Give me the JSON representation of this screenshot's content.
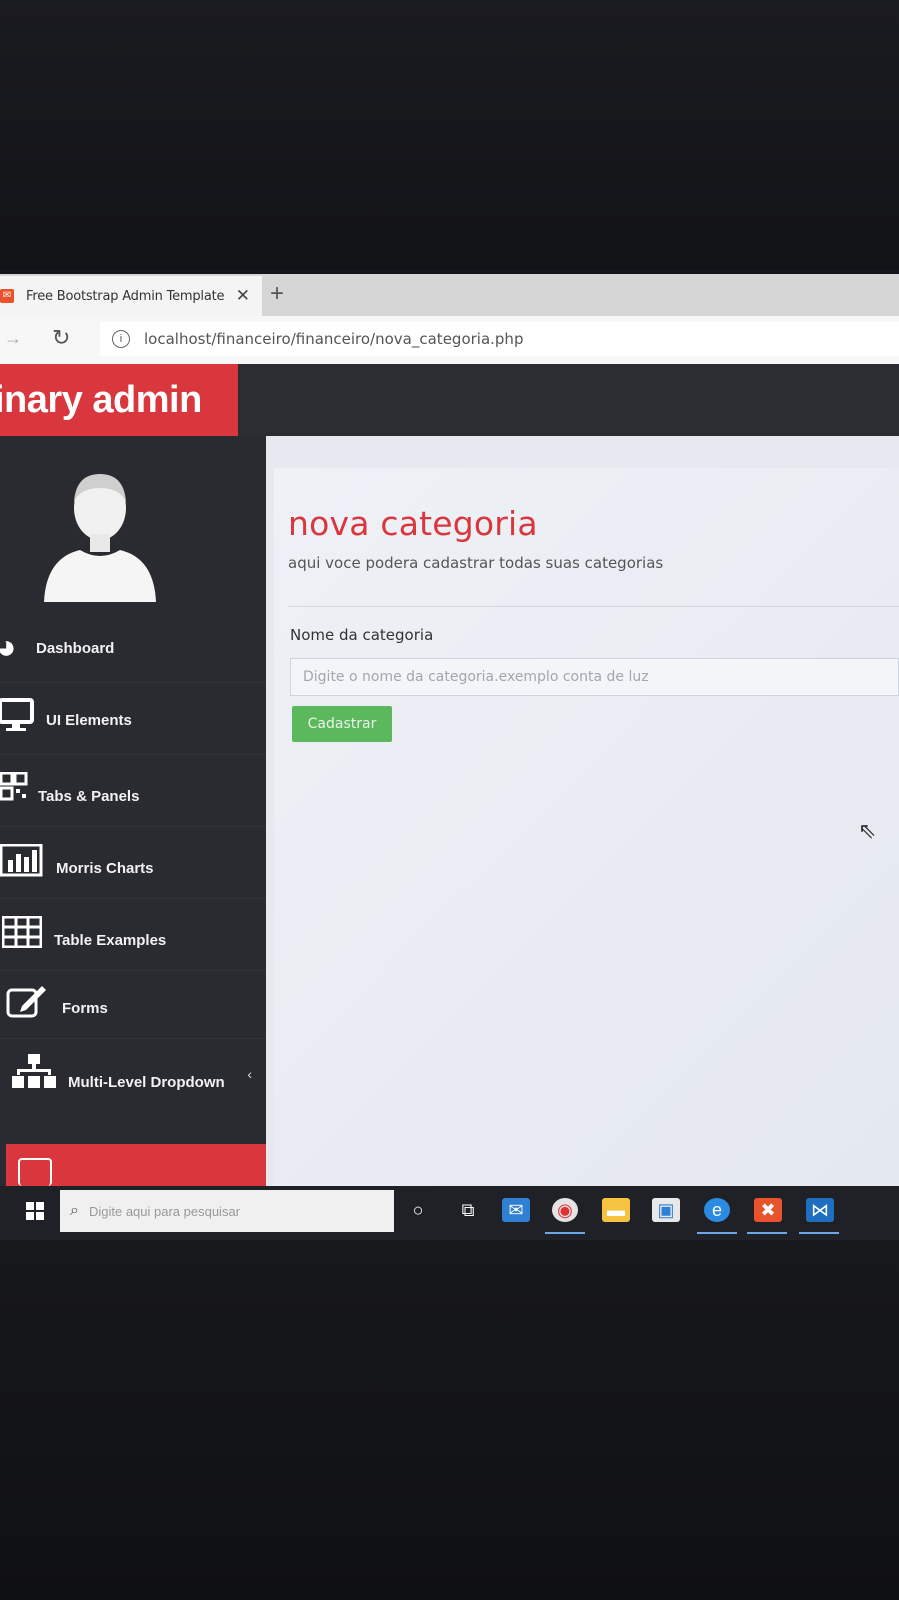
{
  "browser": {
    "tab_title": "Free Bootstrap Admin Template",
    "tab_close": "✕",
    "new_tab": "+",
    "url": "localhost/financeiro/financeiro/nova_categoria.php"
  },
  "app": {
    "brand": "inary admin"
  },
  "sidebar": {
    "items": [
      {
        "label": "Dashboard",
        "icon": "palette-icon"
      },
      {
        "label": "UI Elements",
        "icon": "desktop-icon"
      },
      {
        "label": "Tabs & Panels",
        "icon": "qrcode-icon"
      },
      {
        "label": "Morris Charts",
        "icon": "bar-chart-icon"
      },
      {
        "label": "Table Examples",
        "icon": "table-icon"
      },
      {
        "label": "Forms",
        "icon": "edit-icon"
      },
      {
        "label": "Multi-Level Dropdown",
        "icon": "sitemap-icon"
      }
    ],
    "collapse": "‹"
  },
  "main": {
    "title": "nova categoria",
    "subtitle": "aqui voce podera cadastrar todas suas categorias",
    "field_label": "Nome da categoria",
    "field_placeholder": "Digite o nome da categoria.exemplo conta de luz",
    "submit_label": "Cadastrar"
  },
  "taskbar": {
    "search_placeholder": "Digite aqui para pesquisar"
  },
  "colors": {
    "accent": "#d9363e",
    "sidebar": "#292b31",
    "success": "#5cb85c"
  }
}
